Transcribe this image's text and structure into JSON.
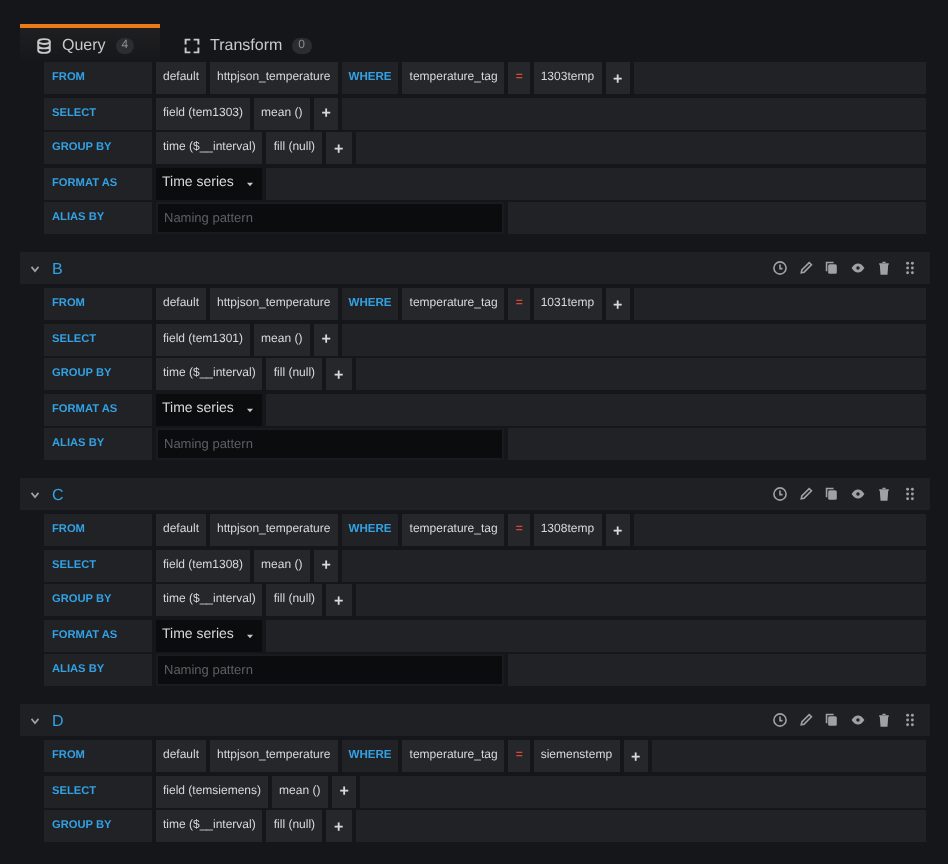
{
  "tabs": [
    {
      "label": "Query",
      "count": "4",
      "selected": true
    },
    {
      "label": "Transform",
      "count": "0",
      "selected": false
    }
  ],
  "queries": [
    {
      "rows": [
        {
          "label": "FROM",
          "kind": "segments",
          "segments": [
            {
              "text": "default",
              "kind": "part"
            },
            {
              "text": "httpjson_temperature",
              "kind": "part"
            },
            {
              "text": "WHERE",
              "kind": "keyword"
            },
            {
              "text": "temperature_tag",
              "kind": "part"
            },
            {
              "text": "=",
              "kind": "operator"
            },
            {
              "text": "1303temp",
              "kind": "part"
            },
            {
              "text": "+",
              "kind": "add"
            }
          ]
        },
        {
          "label": "SELECT",
          "kind": "segments",
          "segments": [
            {
              "text": "field (tem1303)",
              "kind": "part"
            },
            {
              "text": "mean ()",
              "kind": "part"
            },
            {
              "text": "+",
              "kind": "add"
            }
          ]
        },
        {
          "label": "GROUP BY",
          "kind": "segments",
          "segments": [
            {
              "text": "time ($__interval)",
              "kind": "part"
            },
            {
              "text": "fill (null)",
              "kind": "part"
            },
            {
              "text": "+",
              "kind": "add"
            }
          ]
        },
        {
          "label": "FORMAT AS",
          "kind": "select",
          "value": "Time series"
        },
        {
          "label": "ALIAS BY",
          "kind": "input",
          "placeholder": "Naming pattern"
        }
      ]
    },
    {
      "letter": "B",
      "expanded": true,
      "rows": [
        {
          "label": "FROM",
          "kind": "segments",
          "segments": [
            {
              "text": "default",
              "kind": "part"
            },
            {
              "text": "httpjson_temperature",
              "kind": "part"
            },
            {
              "text": "WHERE",
              "kind": "keyword"
            },
            {
              "text": "temperature_tag",
              "kind": "part"
            },
            {
              "text": "=",
              "kind": "operator"
            },
            {
              "text": "1031temp",
              "kind": "part"
            },
            {
              "text": "+",
              "kind": "add"
            }
          ]
        },
        {
          "label": "SELECT",
          "kind": "segments",
          "segments": [
            {
              "text": "field (tem1301)",
              "kind": "part"
            },
            {
              "text": "mean ()",
              "kind": "part"
            },
            {
              "text": "+",
              "kind": "add"
            }
          ]
        },
        {
          "label": "GROUP BY",
          "kind": "segments",
          "segments": [
            {
              "text": "time ($__interval)",
              "kind": "part"
            },
            {
              "text": "fill (null)",
              "kind": "part"
            },
            {
              "text": "+",
              "kind": "add"
            }
          ]
        },
        {
          "label": "FORMAT AS",
          "kind": "select",
          "value": "Time series"
        },
        {
          "label": "ALIAS BY",
          "kind": "input",
          "placeholder": "Naming pattern"
        }
      ]
    },
    {
      "letter": "C",
      "expanded": true,
      "rows": [
        {
          "label": "FROM",
          "kind": "segments",
          "segments": [
            {
              "text": "default",
              "kind": "part"
            },
            {
              "text": "httpjson_temperature",
              "kind": "part"
            },
            {
              "text": "WHERE",
              "kind": "keyword"
            },
            {
              "text": "temperature_tag",
              "kind": "part"
            },
            {
              "text": "=",
              "kind": "operator"
            },
            {
              "text": "1308temp",
              "kind": "part"
            },
            {
              "text": "+",
              "kind": "add"
            }
          ]
        },
        {
          "label": "SELECT",
          "kind": "segments",
          "segments": [
            {
              "text": "field (tem1308)",
              "kind": "part"
            },
            {
              "text": "mean ()",
              "kind": "part"
            },
            {
              "text": "+",
              "kind": "add"
            }
          ]
        },
        {
          "label": "GROUP BY",
          "kind": "segments",
          "segments": [
            {
              "text": "time ($__interval)",
              "kind": "part"
            },
            {
              "text": "fill (null)",
              "kind": "part"
            },
            {
              "text": "+",
              "kind": "add"
            }
          ]
        },
        {
          "label": "FORMAT AS",
          "kind": "select",
          "value": "Time series"
        },
        {
          "label": "ALIAS BY",
          "kind": "input",
          "placeholder": "Naming pattern"
        }
      ]
    },
    {
      "letter": "D",
      "expanded": true,
      "rows": [
        {
          "label": "FROM",
          "kind": "segments",
          "segments": [
            {
              "text": "default",
              "kind": "part"
            },
            {
              "text": "httpjson_temperature",
              "kind": "part"
            },
            {
              "text": "WHERE",
              "kind": "keyword"
            },
            {
              "text": "temperature_tag",
              "kind": "part"
            },
            {
              "text": "=",
              "kind": "operator"
            },
            {
              "text": "siemenstemp",
              "kind": "part"
            },
            {
              "text": "+",
              "kind": "add"
            }
          ]
        },
        {
          "label": "SELECT",
          "kind": "segments",
          "segments": [
            {
              "text": "field (temsiemens)",
              "kind": "part"
            },
            {
              "text": "mean ()",
              "kind": "part"
            },
            {
              "text": "+",
              "kind": "add"
            }
          ]
        },
        {
          "label": "GROUP BY",
          "kind": "segments",
          "segments": [
            {
              "text": "time ($__interval)",
              "kind": "part"
            },
            {
              "text": "fill (null)",
              "kind": "part"
            },
            {
              "text": "+",
              "kind": "add"
            }
          ]
        }
      ]
    }
  ]
}
